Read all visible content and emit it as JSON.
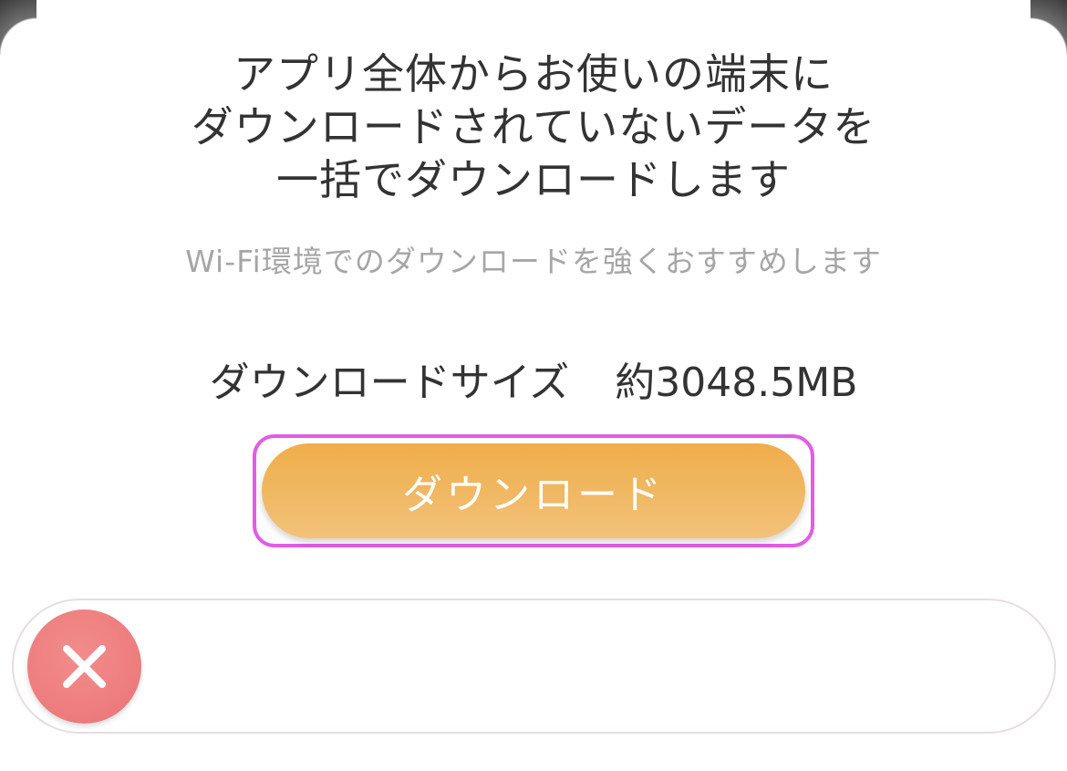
{
  "modal": {
    "heading_lines": [
      "アプリ全体からお使いの端末に",
      "ダウンロードされていないデータを",
      "一括でダウンロードします"
    ],
    "note": "Wi-Fi環境でのダウンロードを強くおすすめします",
    "size_label": "ダウンロードサイズ",
    "size_value": "約3048.5MB",
    "download_button_label": "ダウンロード"
  },
  "close": {
    "icon": "close-icon"
  },
  "colors": {
    "button_gradient_top": "#f0ad4a",
    "button_gradient_bottom": "#f1c27a",
    "highlight_border": "#e25ce6",
    "close_button": "#ee7e7f",
    "heading_text": "#333333",
    "note_text": "#a6a6a6"
  }
}
